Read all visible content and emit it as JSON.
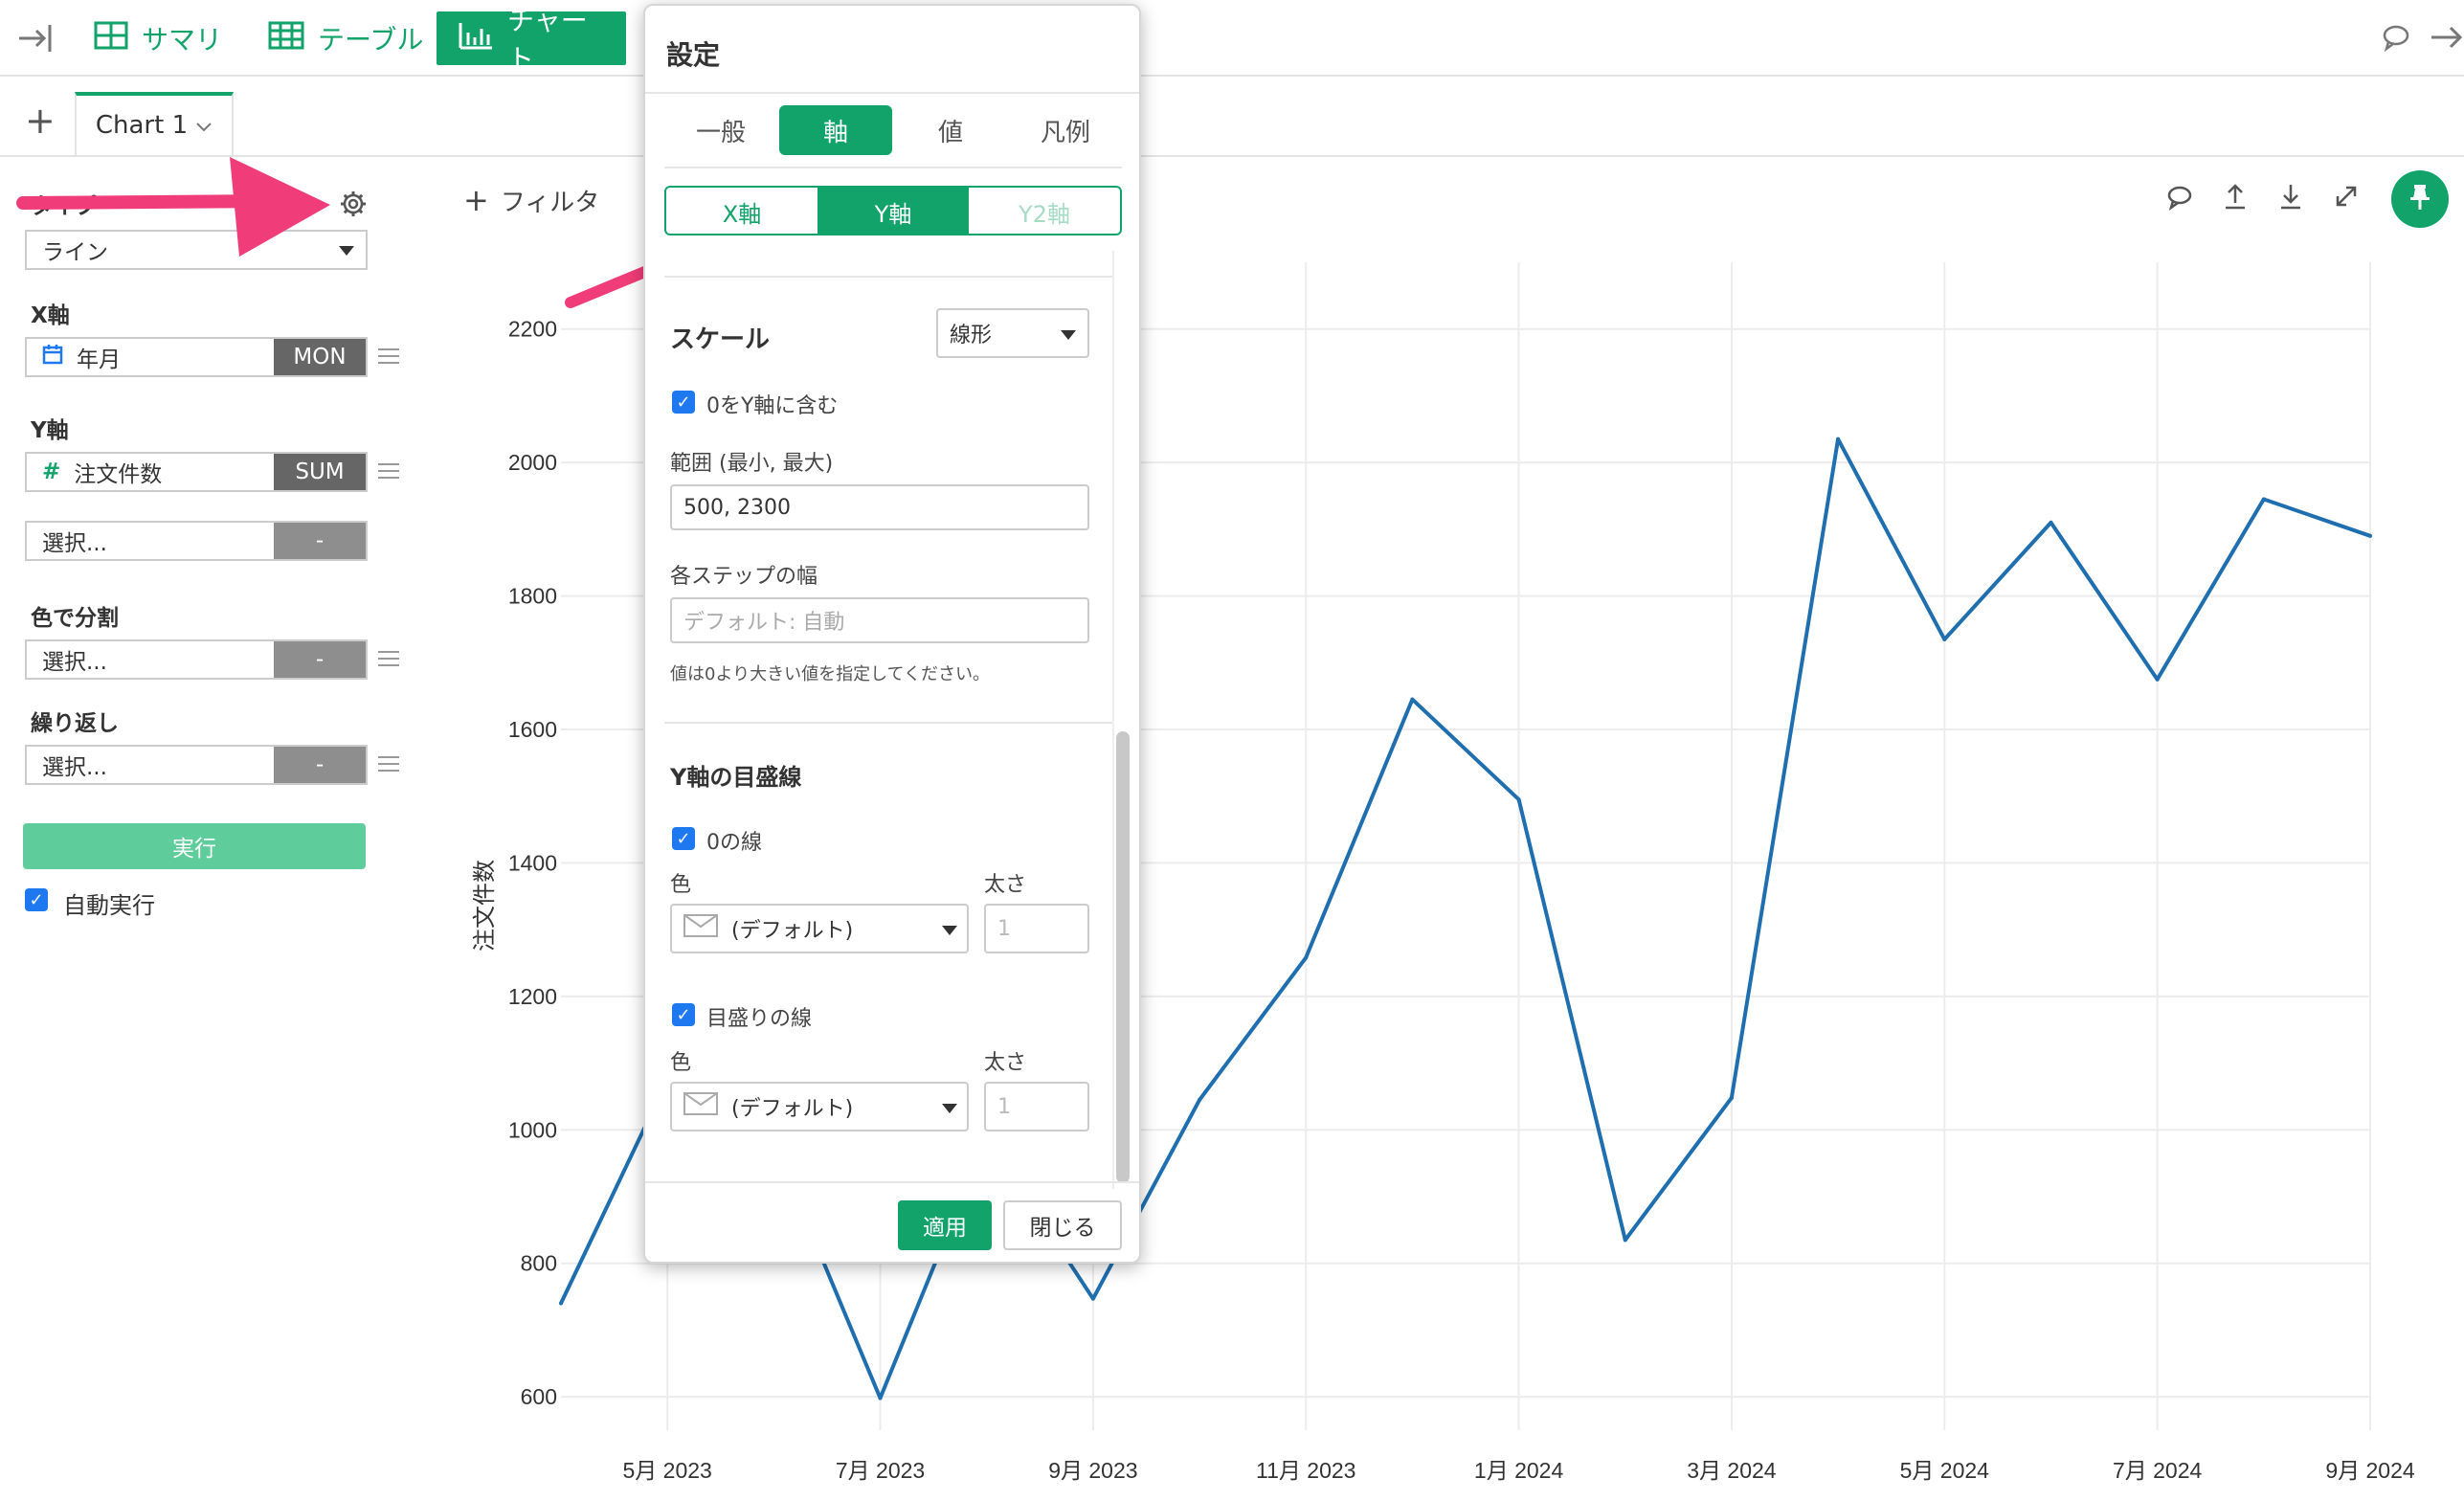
{
  "nav": {
    "summary": "サマリ",
    "table": "テーブル",
    "chart": "チャート"
  },
  "tabs": {
    "add": "+",
    "chart_tab": "Chart 1"
  },
  "left_panel": {
    "type_label": "タイプ",
    "type_value": "ライン",
    "x_axis_label": "X軸",
    "x_field": "年月",
    "x_agg": "MON",
    "y_axis_label": "Y軸",
    "y_field": "注文件数",
    "y_agg": "SUM",
    "y_extra_placeholder": "選択...",
    "y_extra_agg": "-",
    "color_label": "色で分割",
    "color_placeholder": "選択...",
    "color_agg": "-",
    "repeat_label": "繰り返し",
    "repeat_placeholder": "選択...",
    "repeat_agg": "-",
    "run_button": "実行",
    "auto_run": "自動実行"
  },
  "toolbar": {
    "filter": "フィルタ"
  },
  "dialog": {
    "title": "設定",
    "tabs": [
      "一般",
      "軸",
      "値",
      "凡例"
    ],
    "active_tab": "軸",
    "axis_tabs": [
      "X軸",
      "Y軸",
      "Y2軸"
    ],
    "active_axis": "Y軸",
    "scale_label": "スケール",
    "scale_value": "線形",
    "include_zero": "0をY軸に含む",
    "range_label": "範囲 (最小, 最大)",
    "range_value": "500, 2300",
    "step_label": "各ステップの幅",
    "step_placeholder": "デフォルト: 自動",
    "step_help": "値は0より大きい値を指定してください。",
    "gridline_title": "Y軸の目盛線",
    "zero_line": "0の線",
    "zero_color_label": "色",
    "zero_color_value": "(デフォルト)",
    "zero_width_label": "太さ",
    "zero_width_placeholder": "1",
    "grid_line": "目盛りの線",
    "grid_color_label": "色",
    "grid_color_value": "(デフォルト)",
    "grid_width_label": "太さ",
    "grid_width_placeholder": "1",
    "apply": "適用",
    "close": "閉じる"
  },
  "colors": {
    "accent": "#11a36a",
    "line": "#1f6fb0",
    "arrow": "#f03c78",
    "checkbox": "#1e78ef"
  },
  "chart_data": {
    "type": "line",
    "title": "",
    "xlabel": "",
    "ylabel": "注文件数",
    "ylim": [
      550,
      2300
    ],
    "yticks": [
      600,
      800,
      1000,
      1200,
      1400,
      1600,
      1800,
      2000,
      2200
    ],
    "x_tick_labels": [
      "5月 2023",
      "7月 2023",
      "9月 2023",
      "11月 2023",
      "1月 2024",
      "3月 2024",
      "5月 2024",
      "7月 2024",
      "9月 2024"
    ],
    "x": [
      "2023-04",
      "2023-05",
      "2023-06",
      "2023-07",
      "2023-08",
      "2023-09",
      "2023-10",
      "2023-11",
      "2023-12",
      "2024-01",
      "2024-02",
      "2024-03",
      "2024-04",
      "2024-05",
      "2024-06",
      "2024-07",
      "2024-08",
      "2024-09"
    ],
    "series": [
      {
        "values": [
          740,
          1075,
          980,
          598,
          990,
          747,
          1045,
          1258,
          1645,
          1495,
          835,
          1048,
          2035,
          1735,
          1910,
          1675,
          1945,
          1890
        ]
      }
    ],
    "grid": true
  }
}
